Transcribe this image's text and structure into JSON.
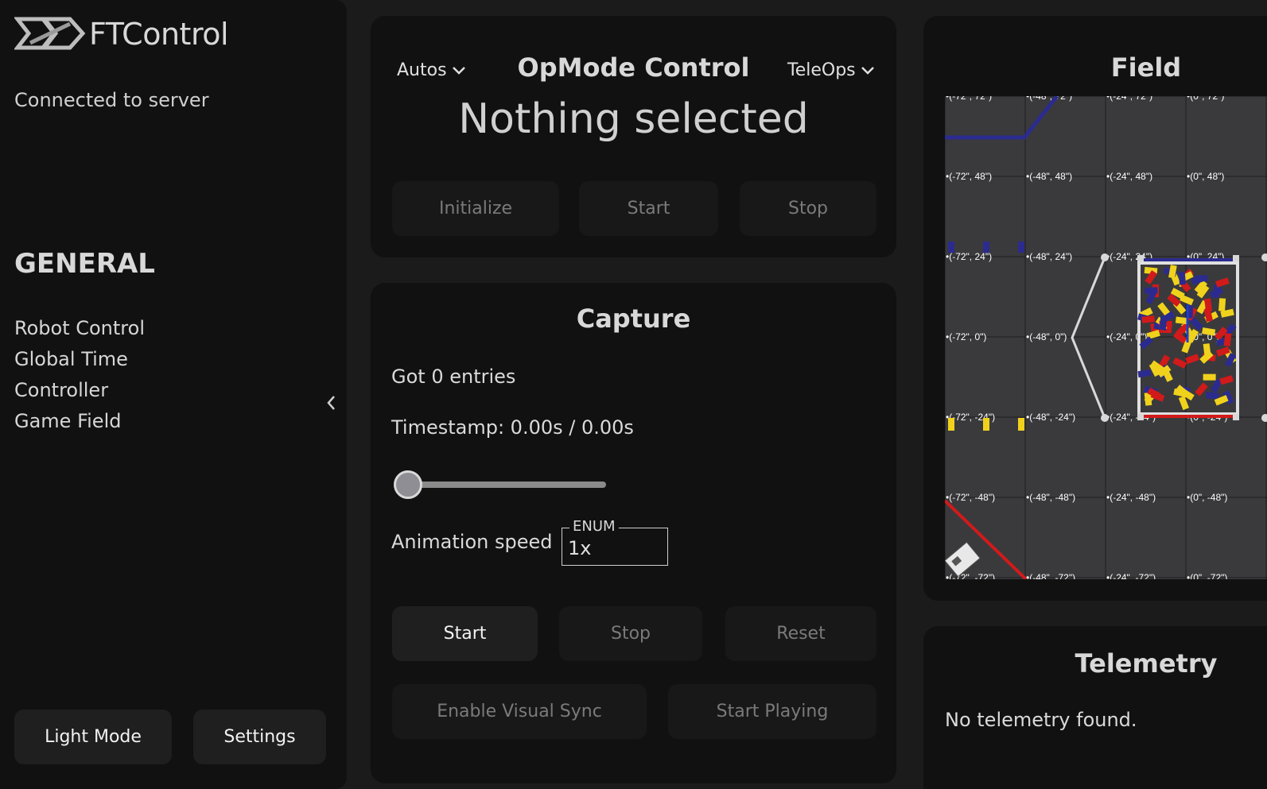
{
  "app": {
    "name": "FTControl",
    "connection_status": "Connected to server"
  },
  "sidebar": {
    "section": "GENERAL",
    "items": [
      {
        "label": "Robot Control"
      },
      {
        "label": "Global Time"
      },
      {
        "label": "Controller"
      },
      {
        "label": "Game Field"
      }
    ],
    "collapse_icon": "chevron-left-icon",
    "buttons": {
      "light_mode": "Light Mode",
      "settings": "Settings"
    }
  },
  "opmode": {
    "title": "OpMode Control",
    "autos_label": "Autos",
    "teleops_label": "TeleOps",
    "selected": "Nothing selected",
    "buttons": {
      "initialize": "Initialize",
      "start": "Start",
      "stop": "Stop"
    }
  },
  "capture": {
    "title": "Capture",
    "entries": "Got 0 entries",
    "timestamp": "Timestamp: 0.00s / 0.00s",
    "slider_value": 0,
    "animation_speed_label": "Animation speed",
    "enum_label": "ENUM",
    "enum_value": "1x",
    "buttons": {
      "start": "Start",
      "stop": "Stop",
      "reset": "Reset",
      "visual_sync": "Enable Visual Sync",
      "start_playing": "Start Playing"
    }
  },
  "field": {
    "title": "Field",
    "tick_labels_x": [
      "-72\"",
      "-48\"",
      "-24\"",
      "0\""
    ],
    "tick_labels_y": [
      "72\"",
      "48\"",
      "24\"",
      "0\"",
      "-24\"",
      "-48\"",
      "-72\""
    ],
    "labels": [
      [
        "(-72\", 72\")",
        "(-48\", 72\")",
        "(-24\", 72\")",
        "(0\", 72\")"
      ],
      [
        "(-72\", 48\")",
        "(-48\", 48\")",
        "(-24\", 48\")",
        "(0\", 48\")"
      ],
      [
        "(-72\", 24\")",
        "(-48\", 24\")",
        "(-24\", 24\")",
        "(0\", 24\")"
      ],
      [
        "(-72\", 0\")",
        "(-48\", 0\")",
        "(-24\", 0\")",
        "(0\", 0\")"
      ],
      [
        "(-72\", -24\")",
        "(-48\", -24\")",
        "(-24\", -24\")",
        "(0\", -24\")"
      ],
      [
        "(-72\", -48\")",
        "(-48\", -48\")",
        "(-24\", -48\")",
        "(0\", -48\")"
      ],
      [
        "(-72\", -72\")",
        "(-48\", -72\")",
        "(-24\", -72\")",
        "(0\", -72\")"
      ]
    ],
    "colors": {
      "background": "#3a3a3d",
      "grid": "#1e1e1e",
      "blue": "#2b2b8f",
      "red": "#d11a1a",
      "yellow": "#f0d21c"
    }
  },
  "telemetry": {
    "title": "Telemetry",
    "empty": "No telemetry found."
  }
}
